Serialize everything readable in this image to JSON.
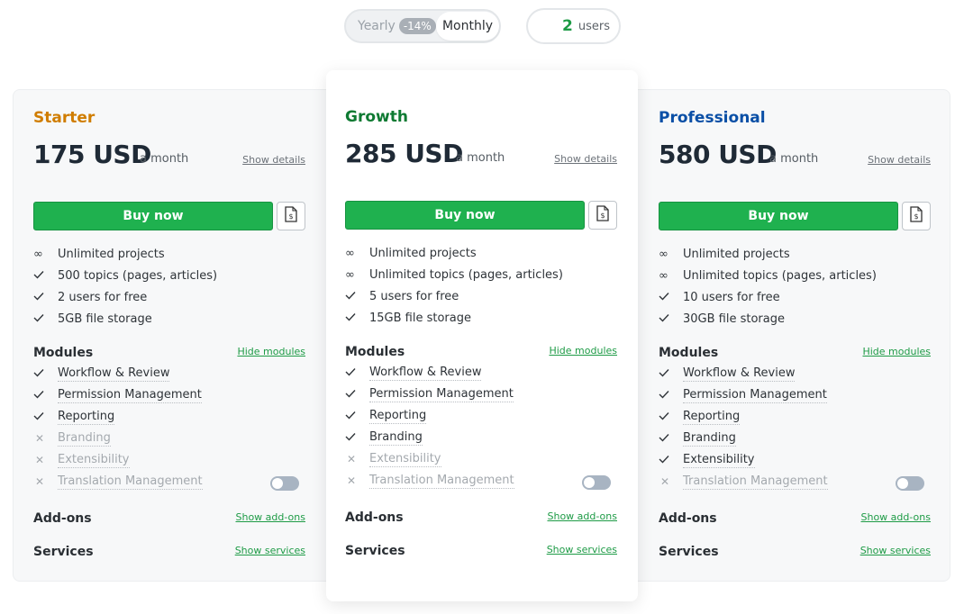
{
  "toolbar": {
    "yearly_label": "Yearly",
    "yearly_discount": "-14%",
    "monthly_label": "Monthly",
    "users_count": "2",
    "users_label": "users"
  },
  "colors": {
    "buy_green": "#1fb14f",
    "link_green": "#1e9b46",
    "starter": "#d07d00",
    "growth": "#0e7a32",
    "professional": "#0a4fa6"
  },
  "plans": [
    {
      "name": "Starter",
      "price": "175 USD",
      "period": "a month",
      "details_link": "Show details",
      "buy_label": "Buy now",
      "invoice_icon": "invoice-dollar-icon",
      "features": [
        {
          "icon": "infinity",
          "text": "Unlimited projects"
        },
        {
          "icon": "check",
          "text": "500 topics (pages, articles)"
        },
        {
          "icon": "check",
          "text": "2 users for free"
        },
        {
          "icon": "check",
          "text": "5GB file storage"
        }
      ],
      "modules_title": "Modules",
      "modules_link": "Hide modules",
      "modules": [
        {
          "text": "Workflow & Review",
          "included": true
        },
        {
          "text": "Permission Management",
          "included": true
        },
        {
          "text": "Reporting",
          "included": true
        },
        {
          "text": "Branding",
          "included": false
        },
        {
          "text": "Extensibility",
          "included": false
        },
        {
          "text": "Translation Management",
          "included": false
        }
      ],
      "addons_title": "Add-ons",
      "addons_link": "Show add-ons",
      "services_title": "Services",
      "services_link": "Show services"
    },
    {
      "name": "Growth",
      "price": "285 USD",
      "period": "a month",
      "details_link": "Show details",
      "buy_label": "Buy now",
      "invoice_icon": "invoice-dollar-icon",
      "features": [
        {
          "icon": "infinity",
          "text": "Unlimited projects"
        },
        {
          "icon": "infinity",
          "text": "Unlimited topics (pages, articles)"
        },
        {
          "icon": "check",
          "text": "5 users for free"
        },
        {
          "icon": "check",
          "text": "15GB file storage"
        }
      ],
      "modules_title": "Modules",
      "modules_link": "Hide modules",
      "modules": [
        {
          "text": "Workflow & Review",
          "included": true
        },
        {
          "text": "Permission Management",
          "included": true
        },
        {
          "text": "Reporting",
          "included": true
        },
        {
          "text": "Branding",
          "included": true
        },
        {
          "text": "Extensibility",
          "included": false
        },
        {
          "text": "Translation Management",
          "included": false
        }
      ],
      "addons_title": "Add-ons",
      "addons_link": "Show add-ons",
      "services_title": "Services",
      "services_link": "Show services"
    },
    {
      "name": "Professional",
      "price": "580 USD",
      "period": "a month",
      "details_link": "Show details",
      "buy_label": "Buy now",
      "invoice_icon": "invoice-dollar-icon",
      "features": [
        {
          "icon": "infinity",
          "text": "Unlimited projects"
        },
        {
          "icon": "infinity",
          "text": "Unlimited topics (pages, articles)"
        },
        {
          "icon": "check",
          "text": "10 users for free"
        },
        {
          "icon": "check",
          "text": "30GB file storage"
        }
      ],
      "modules_title": "Modules",
      "modules_link": "Hide modules",
      "modules": [
        {
          "text": "Workflow & Review",
          "included": true
        },
        {
          "text": "Permission Management",
          "included": true
        },
        {
          "text": "Reporting",
          "included": true
        },
        {
          "text": "Branding",
          "included": true
        },
        {
          "text": "Extensibility",
          "included": true
        },
        {
          "text": "Translation Management",
          "included": false
        }
      ],
      "addons_title": "Add-ons",
      "addons_link": "Show add-ons",
      "services_title": "Services",
      "services_link": "Show services"
    }
  ]
}
